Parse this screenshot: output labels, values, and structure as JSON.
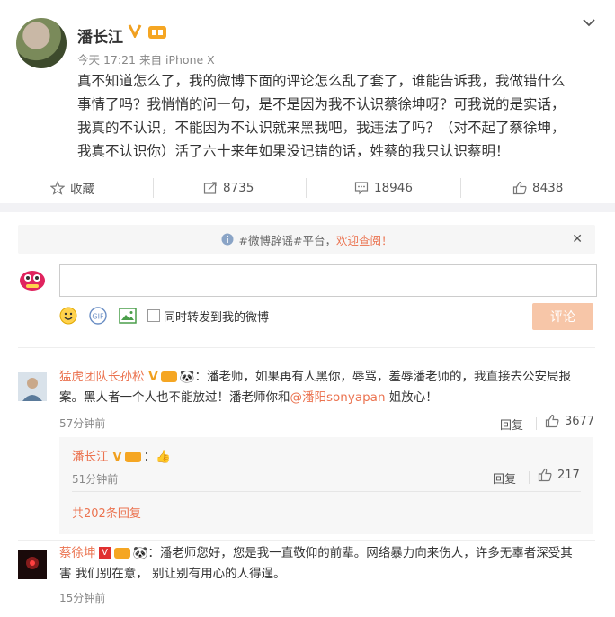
{
  "post": {
    "author": "潘长江",
    "time": "今天 17:21",
    "source_prefix": "来自",
    "source": "iPhone X",
    "lines": [
      "真不知道怎么了，我的微博下面的评论怎么乱了套了，谁能告诉我，我做错什么",
      "事情了吗？我悄悄的问一句，是不是因为我不认识蔡徐坤呀？可我说的是实话，",
      "我真的不认识，不能因为不认识就来黑我吧，我违法了吗？（对不起了蔡徐坤，",
      "我真不认识你）活了六十来年如果没记错的话，姓蔡的我只认识蔡明！"
    ]
  },
  "actions": {
    "favorite_label": "收藏",
    "repost_count": "8735",
    "comment_count": "18946",
    "like_count": "8438"
  },
  "notice": {
    "prefix": "#微博辟谣#平台，",
    "link": "欢迎查阅！"
  },
  "composer": {
    "placeholder": "",
    "repost_option": "同时转发到我的微博",
    "submit_label": "评论"
  },
  "comments": [
    {
      "user": "猛虎团队长孙松",
      "suffix": "：潘老师，如果再有人黑你，辱骂，羞辱潘老师的，我直接去公安局报",
      "line2_pre": "案。黑人者一个人也不能放过！潘老师你和",
      "mention": "@潘阳sonyapan",
      "line2_post": " 姐放心！",
      "time": "57分钟前",
      "reply_label": "回复",
      "likes": "3677"
    },
    {
      "user": "潘长江",
      "suffix": "：",
      "time": "51分钟前",
      "reply_label": "回复",
      "likes": "217",
      "more_replies": "共202条回复"
    },
    {
      "user": "蔡徐坤",
      "suffix": "：潘老师您好，您是我一直敬仰的前辈。网络暴力向来伤人，许多无辜者深受其",
      "line2": "害 我们别在意， 别让别有用心的人得逞。",
      "time": "15分钟前"
    }
  ],
  "colors": {
    "accent": "#eb7350",
    "verified": "#f0a020",
    "submit_disabled": "#f7c6a8"
  }
}
